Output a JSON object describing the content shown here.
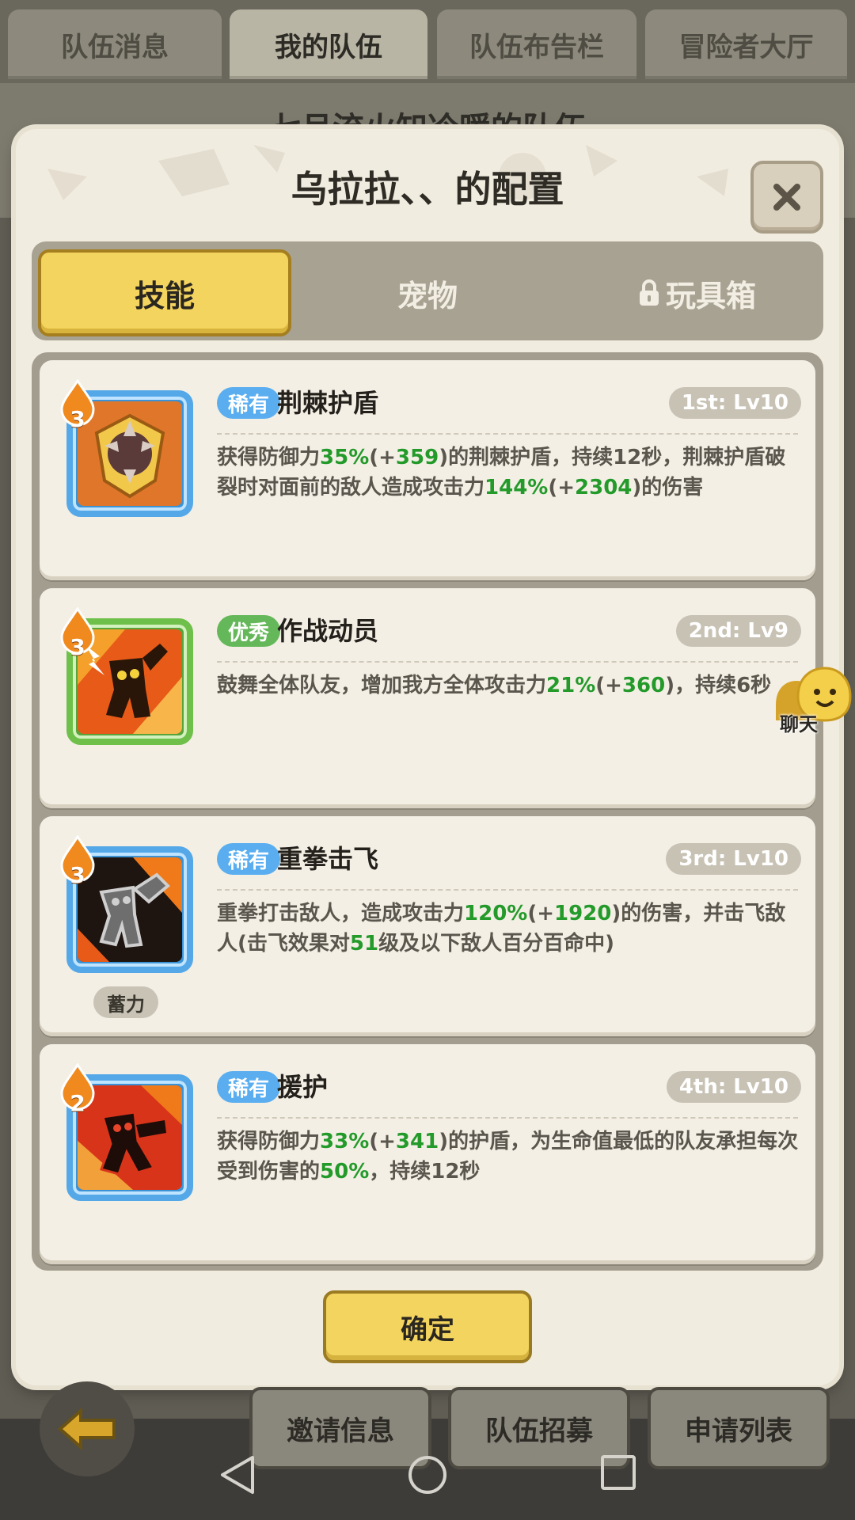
{
  "background": {
    "tabs": [
      "队伍消息",
      "我的队伍",
      "队伍布告栏",
      "冒险者大厅"
    ],
    "active_tab_index": 1,
    "header_title": "七月流火知冷暖的队伍",
    "bottom_buttons": [
      "邀请信息",
      "队伍招募",
      "申请列表"
    ]
  },
  "modal": {
    "title": "乌拉拉、、的配置",
    "tabs": {
      "skill": "技能",
      "pet": "宠物",
      "toy": "玩具箱"
    },
    "confirm_label": "确定",
    "chat_label": "聊天"
  },
  "skills": [
    {
      "rarity": "稀有",
      "name": "荆棘护盾",
      "slot": "1st: Lv10",
      "level": "3",
      "icon": "thorn-shield-icon",
      "desc": [
        "获得防御力",
        "35%",
        "(+",
        "359",
        ")的荆棘护盾，持续12秒，荆棘护盾破裂时对面前的敌人造成攻击力",
        "144%",
        "(+",
        "2304",
        ")的伤害"
      ]
    },
    {
      "rarity": "优秀",
      "name": "作战动员",
      "slot": "2nd: Lv9",
      "level": "3",
      "icon": "battle-rally-icon",
      "desc": [
        "鼓舞全体队友，增加我方全体攻击力",
        "21%",
        "(+",
        "360",
        ")，持续6秒"
      ]
    },
    {
      "rarity": "稀有",
      "name": "重拳击飞",
      "slot": "3rd: Lv10",
      "level": "3",
      "icon": "heavy-punch-icon",
      "badge": "蓄力",
      "desc": [
        "重拳打击敌人，造成攻击力",
        "120%",
        "(+",
        "1920",
        ")的伤害，并击飞敌人(击飞效果对",
        "51",
        "级及以下敌人百分百命中)"
      ]
    },
    {
      "rarity": "稀有",
      "name": "援护",
      "slot": "4th: Lv10",
      "level": "2",
      "icon": "guard-icon",
      "desc": [
        "获得防御力",
        "33%",
        "(+",
        "341",
        ")的护盾，为生命值最低的队友承担每次受到伤害的",
        "50%",
        "，持续12秒"
      ]
    }
  ],
  "colors": {
    "highlight": "#239a2a",
    "rare": "#5aaef0",
    "good": "#65b85a",
    "accent": "#f3d45e"
  }
}
